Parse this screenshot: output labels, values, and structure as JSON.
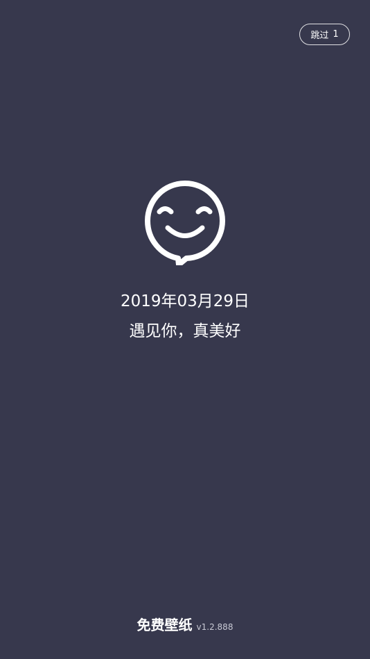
{
  "skip": {
    "label": "跳过",
    "countdown": "1"
  },
  "logo": {
    "icon": "smiley-chat-bubble-icon"
  },
  "greeting": {
    "date": "2019年03月29日",
    "slogan": "遇见你，真美好"
  },
  "footer": {
    "app_name": "免费壁纸",
    "version": "v1.2.888"
  },
  "colors": {
    "background": "#37384d",
    "foreground": "#ffffff"
  }
}
